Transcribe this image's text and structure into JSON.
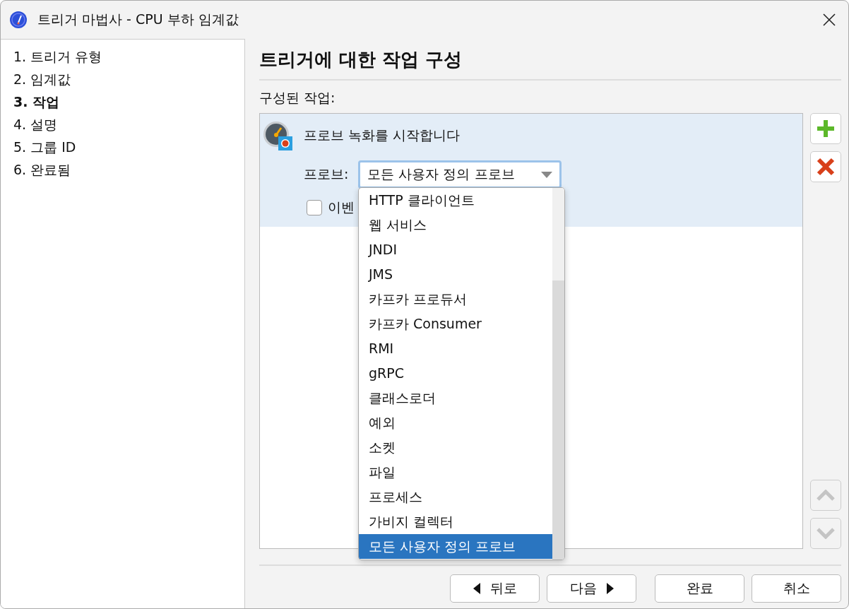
{
  "window": {
    "title": "트리거 마법사 - CPU 부하 임계값"
  },
  "steps": [
    {
      "label": "1. 트리거 유형",
      "selected": false
    },
    {
      "label": "2. 임계값",
      "selected": false
    },
    {
      "label": "3. 작업",
      "selected": true
    },
    {
      "label": "4. 설명",
      "selected": false
    },
    {
      "label": "5. 그룹 ID",
      "selected": false
    },
    {
      "label": "6. 완료됨",
      "selected": false
    }
  ],
  "heading": "트리거에 대한 작업 구성",
  "actions_label": "구성된 작업:",
  "action": {
    "title": "프로브 녹화를 시작합니다",
    "probe_label": "프로브:",
    "probe_value": "모든 사용자 정의 프로브",
    "checkbox": {
      "label": "이벤",
      "checked": false
    }
  },
  "dropdown": [
    {
      "label": "HTTP 클라이언트",
      "selected": false
    },
    {
      "label": "웹 서비스",
      "selected": false
    },
    {
      "label": "JNDI",
      "selected": false
    },
    {
      "label": "JMS",
      "selected": false
    },
    {
      "label": "카프카 프로듀서",
      "selected": false
    },
    {
      "label": "카프카 Consumer",
      "selected": false
    },
    {
      "label": "RMI",
      "selected": false
    },
    {
      "label": "gRPC",
      "selected": false
    },
    {
      "label": "클래스로더",
      "selected": false
    },
    {
      "label": "예외",
      "selected": false
    },
    {
      "label": "소켓",
      "selected": false
    },
    {
      "label": "파일",
      "selected": false
    },
    {
      "label": "프로세스",
      "selected": false
    },
    {
      "label": "가비지 컬렉터",
      "selected": false
    },
    {
      "label": "모든 사용자 정의 프로브",
      "selected": true
    }
  ],
  "buttons": [
    {
      "label": "뒤로",
      "kind": "back"
    },
    {
      "label": "다음",
      "kind": "next"
    },
    {
      "label": "완료",
      "kind": "plain"
    },
    {
      "label": "취소",
      "kind": "plain"
    }
  ]
}
